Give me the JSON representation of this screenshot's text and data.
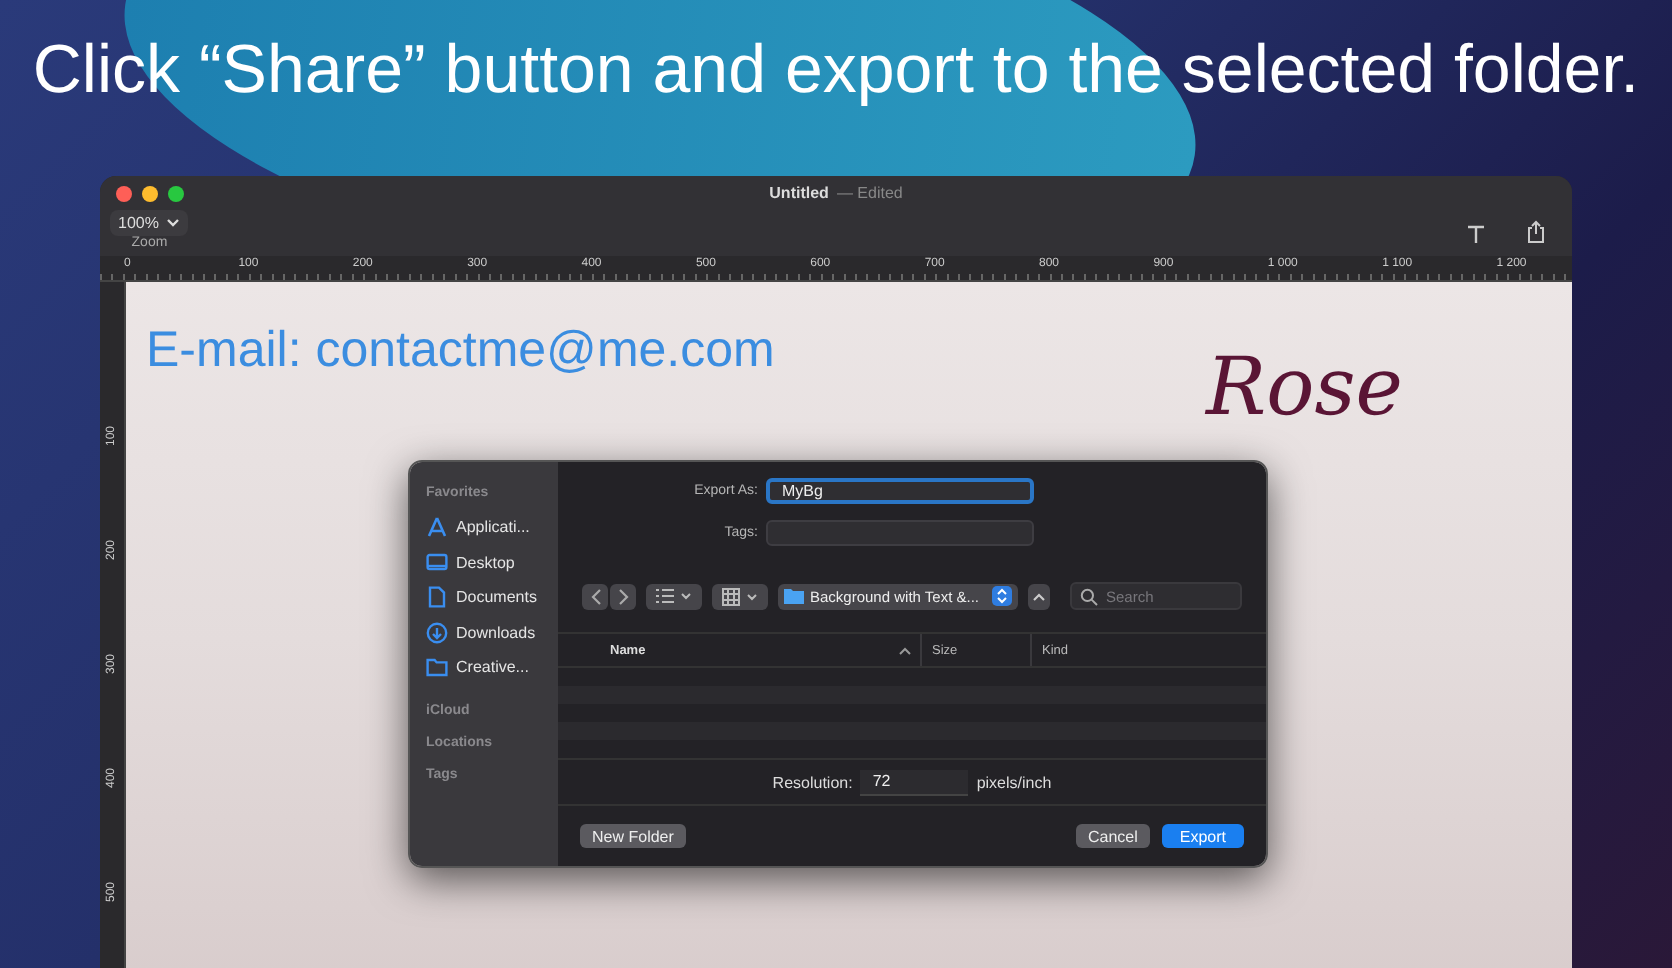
{
  "headline": "Click “Share” button and export to the selected folder.",
  "window": {
    "title": "Untitled",
    "status": "— Edited",
    "zoom": {
      "value": "100%",
      "label": "Zoom"
    }
  },
  "ruler": {
    "labels": [
      "0",
      "100",
      "200",
      "300",
      "400",
      "500",
      "600",
      "700",
      "800",
      "900",
      "1 000",
      "1 100",
      "1 200"
    ],
    "vertical_labels": [
      "100",
      "200",
      "300",
      "400",
      "500"
    ]
  },
  "canvas": {
    "email": "E-mail: contactme@me.com",
    "logo": "Rose"
  },
  "dialog": {
    "export_as": {
      "label": "Export As:",
      "value": "MyBg"
    },
    "tags": {
      "label": "Tags:"
    },
    "location": "Background with Text &...",
    "search": {
      "placeholder": "Search"
    },
    "columns": [
      "Name",
      "Size",
      "Kind"
    ],
    "sidebar": [
      {
        "title": "Favorites",
        "items": [
          {
            "label": "Applicati...",
            "kind": "apps"
          },
          {
            "label": "Desktop",
            "kind": "desktop"
          },
          {
            "label": "Documents",
            "kind": "document"
          },
          {
            "label": "Downloads",
            "kind": "download"
          },
          {
            "label": "Creative...",
            "kind": "folder"
          }
        ]
      },
      {
        "title": "iCloud"
      },
      {
        "title": "Locations"
      },
      {
        "title": "Tags"
      }
    ],
    "resolution": {
      "label": "Resolution:",
      "value": "72",
      "unit": "pixels/inch"
    },
    "buttons": [
      {
        "label": "New Folder",
        "kind": "left"
      },
      {
        "label": "Cancel",
        "kind": "default"
      },
      {
        "label": "Export",
        "kind": "primary"
      }
    ]
  }
}
